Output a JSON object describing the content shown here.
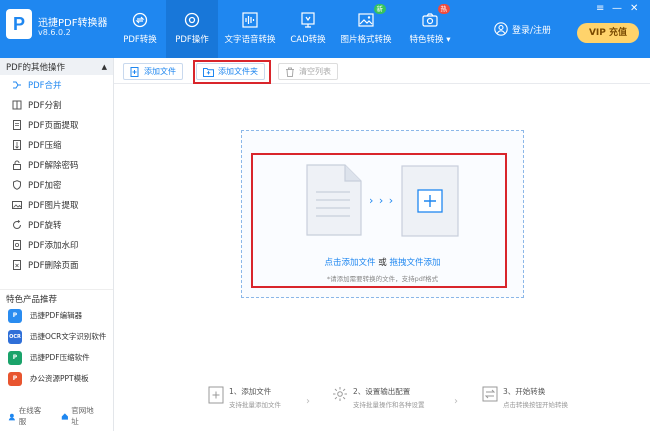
{
  "app": {
    "name": "迅捷PDF转换器",
    "version": "v8.6.0.2",
    "logo_letter": "P"
  },
  "nav": [
    {
      "label": "PDF转换",
      "icon": "refresh-icon"
    },
    {
      "label": "PDF操作",
      "icon": "gear-icon"
    },
    {
      "label": "文字语音转换",
      "icon": "waveform-icon"
    },
    {
      "label": "CAD转换",
      "icon": "cad-icon"
    },
    {
      "label": "图片格式转换",
      "icon": "image-icon",
      "badge": "新"
    },
    {
      "label": "特色转换 ▾",
      "icon": "camera-icon",
      "badge": "热"
    }
  ],
  "header": {
    "login_label": "登录/注册",
    "vip_label": "VIP 充值",
    "window_controls": [
      "≡",
      "—",
      "✕"
    ]
  },
  "sidebar": {
    "section_title": "PDF的其他操作",
    "items": [
      "PDF合并",
      "PDF分割",
      "PDF页面提取",
      "PDF压缩",
      "PDF解除密码",
      "PDF加密",
      "PDF图片提取",
      "PDF旋转",
      "PDF添加水印",
      "PDF删除页面"
    ],
    "products_title": "特色产品推荐",
    "products": [
      {
        "label": "迅捷PDF编辑器",
        "icon_text": "P",
        "color": "#2a8cf0"
      },
      {
        "label": "迅捷OCR文字识别软件",
        "icon_text": "OCR",
        "color": "#2f6fd8"
      },
      {
        "label": "迅捷PDF压缩软件",
        "icon_text": "P",
        "color": "#1aa36a"
      },
      {
        "label": "办公资源PPT模板",
        "icon_text": "P",
        "color": "#e8552f"
      }
    ],
    "footer": {
      "service": "在线客服",
      "site": "官网地址"
    }
  },
  "toolbar": {
    "add_file": "添加文件",
    "add_folder": "添加文件夹",
    "clear_list": "清空列表"
  },
  "dropzone": {
    "link_add": "点击添加文件",
    "or": "或",
    "link_drag": "拖拽文件添加",
    "arrows": "› › ›",
    "hint": "*请添加需要转换的文件，支持pdf格式"
  },
  "steps": [
    {
      "title": "1、添加文件",
      "sub": "支持批量添加文件"
    },
    {
      "title": "2、设置输出配置",
      "sub": "支持批量操作和各种设置"
    },
    {
      "title": "3、开始转换",
      "sub": "点击转换按钮开始转换"
    }
  ],
  "colors": {
    "primary": "#1f87f0",
    "highlight": "#d9252b"
  }
}
